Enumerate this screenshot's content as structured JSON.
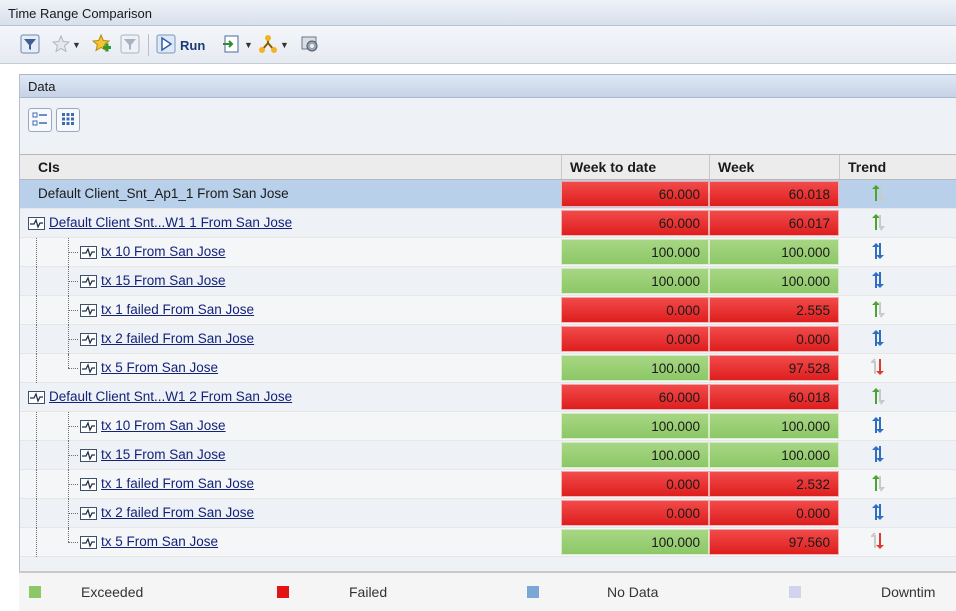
{
  "window": {
    "title": "Time Range Comparison"
  },
  "toolbar": {
    "run_label": "Run"
  },
  "panel": {
    "title": "Data"
  },
  "table": {
    "columns": [
      "CIs",
      "Week to date",
      "Week",
      "Trend"
    ],
    "rows": [
      {
        "name": "Default Client_Snt_Ap1_1 From San Jose",
        "link": false,
        "level": 0,
        "week_to_date": "60.000",
        "week": "60.018",
        "wtd_status": "failed",
        "week_status": "failed",
        "trend": "up",
        "selected": true
      },
      {
        "name": "Default Client  Snt...W1  1 From San Jose",
        "link": true,
        "level": 1,
        "week_to_date": "60.000",
        "week": "60.017",
        "wtd_status": "failed",
        "week_status": "failed",
        "trend": "up"
      },
      {
        "name": "tx  10 From San Jose",
        "link": true,
        "level": 2,
        "week_to_date": "100.000",
        "week": "100.000",
        "wtd_status": "exceeded",
        "week_status": "exceeded",
        "trend": "same"
      },
      {
        "name": "tx  15 From San Jose",
        "link": true,
        "level": 2,
        "week_to_date": "100.000",
        "week": "100.000",
        "wtd_status": "exceeded",
        "week_status": "exceeded",
        "trend": "same"
      },
      {
        "name": "tx  1  failed From San Jose",
        "link": true,
        "level": 2,
        "week_to_date": "0.000",
        "week": "2.555",
        "wtd_status": "failed",
        "week_status": "failed",
        "trend": "up"
      },
      {
        "name": "tx  2  failed From San Jose",
        "link": true,
        "level": 2,
        "week_to_date": "0.000",
        "week": "0.000",
        "wtd_status": "failed",
        "week_status": "failed",
        "trend": "same"
      },
      {
        "name": "tx  5 From San Jose",
        "link": true,
        "level": 2,
        "week_to_date": "100.000",
        "week": "97.528",
        "wtd_status": "exceeded",
        "week_status": "failed",
        "trend": "down"
      },
      {
        "name": "Default Client  Snt...W1  2 From San Jose",
        "link": true,
        "level": 1,
        "week_to_date": "60.000",
        "week": "60.018",
        "wtd_status": "failed",
        "week_status": "failed",
        "trend": "up"
      },
      {
        "name": "tx  10 From San Jose",
        "link": true,
        "level": 2,
        "week_to_date": "100.000",
        "week": "100.000",
        "wtd_status": "exceeded",
        "week_status": "exceeded",
        "trend": "same"
      },
      {
        "name": "tx  15 From San Jose",
        "link": true,
        "level": 2,
        "week_to_date": "100.000",
        "week": "100.000",
        "wtd_status": "exceeded",
        "week_status": "exceeded",
        "trend": "same"
      },
      {
        "name": "tx  1  failed From San Jose",
        "link": true,
        "level": 2,
        "week_to_date": "0.000",
        "week": "2.532",
        "wtd_status": "failed",
        "week_status": "failed",
        "trend": "up"
      },
      {
        "name": "tx  2  failed From San Jose",
        "link": true,
        "level": 2,
        "week_to_date": "0.000",
        "week": "0.000",
        "wtd_status": "failed",
        "week_status": "failed",
        "trend": "same"
      },
      {
        "name": "tx  5 From San Jose",
        "link": true,
        "level": 2,
        "week_to_date": "100.000",
        "week": "97.560",
        "wtd_status": "exceeded",
        "week_status": "failed",
        "trend": "down"
      }
    ]
  },
  "legend": [
    {
      "label": "Exceeded",
      "color": "#8cc866"
    },
    {
      "label": "Failed",
      "color": "#e21414"
    },
    {
      "label": "No Data",
      "color": "#7aa7d8"
    },
    {
      "label": "Downtim",
      "color": "#d3d3f0"
    }
  ],
  "colors": {
    "exceeded": "#8cc866",
    "failed": "#e21414",
    "selected_row": "#b8d0ea",
    "link": "#13237a"
  }
}
